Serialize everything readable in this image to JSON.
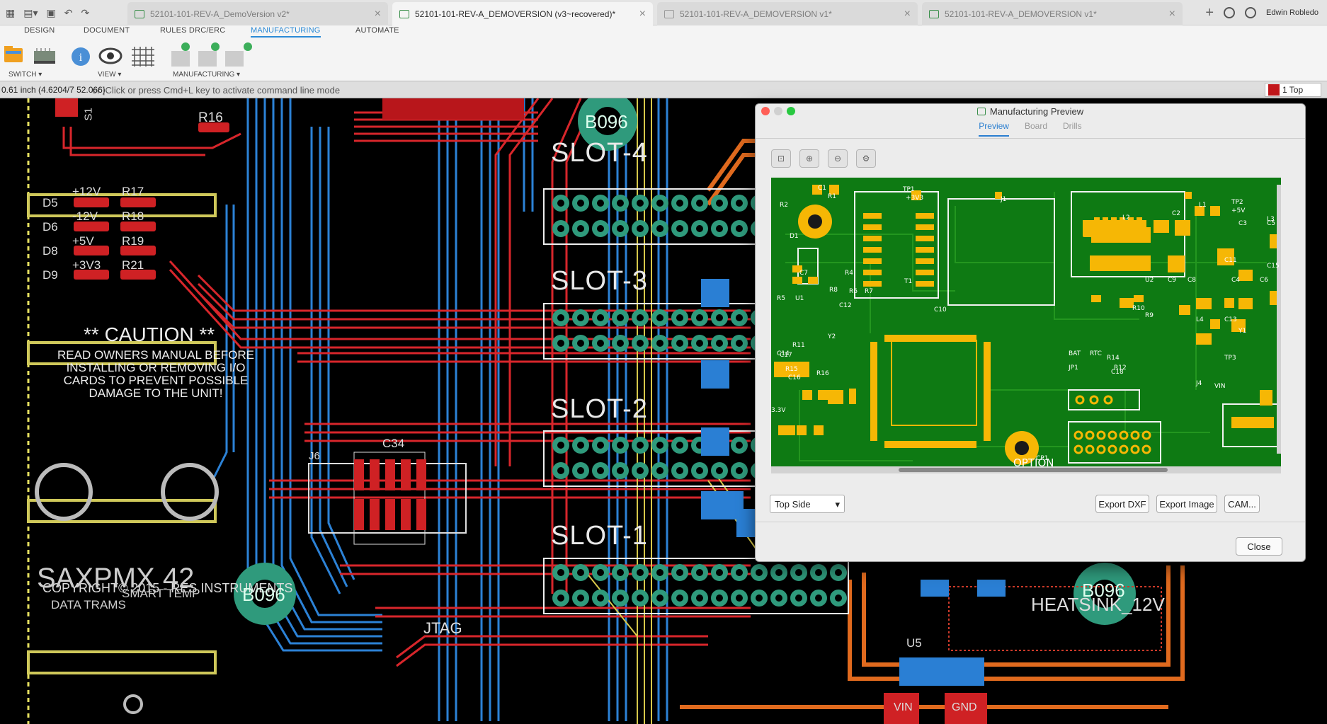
{
  "tabs": [
    {
      "label": "52101-101-REV-A_DemoVersion v2*",
      "active": false
    },
    {
      "label": "52101-101-REV-A_DEMOVERSION (v3~recovered)*",
      "active": true
    },
    {
      "label": "52101-101-REV-A_DEMOVERSION v1*",
      "active": false
    },
    {
      "label": "52101-101-REV-A_DEMOVERSION v1*",
      "active": false
    }
  ],
  "user": "Edwin Robledo",
  "menu": [
    "DESIGN",
    "DOCUMENT",
    "RULES DRC/ERC",
    "MANUFACTURING",
    "AUTOMATE"
  ],
  "groups": {
    "switch": "SWITCH ▾",
    "view": "VIEW ▾",
    "manufacturing": "MANUFACTURING ▾"
  },
  "cmdline": {
    "coords": "0.61 inch (4.6204/7 52.066)",
    "hint": "or |Click or press Cmd+L key to activate command line mode",
    "layer": "1 Top"
  },
  "board": {
    "slots": [
      "SLOT-4",
      "SLOT-3",
      "SLOT-2",
      "SLOT-1"
    ],
    "caution_title": "** CAUTION **",
    "caution_body": [
      "READ OWNERS MANUAL BEFORE",
      "INSTALLING OR REMOVING I/O",
      "CARDS TO PREVENT POSSIBLE",
      "DAMAGE TO THE UNIT!"
    ],
    "copyright": "COPYRIGHT© 2015 - RES INSTRUMENTS",
    "hole_labels": [
      "B096",
      "B096",
      "B096"
    ],
    "heatsink": "HEATSINK_12V",
    "jtag": "JTAG",
    "refs": [
      "R16",
      "D5",
      "D6",
      "D8",
      "D9",
      "+12V",
      "-12V",
      "+5V",
      "+3V3",
      "R17",
      "R18",
      "R19",
      "R21",
      "C34",
      "U5",
      "VIN",
      "GND",
      "J6",
      "S1"
    ],
    "logo": [
      "SAXPMX 42",
      "SMART TEMP",
      "DATA TRAMS"
    ]
  },
  "dialog": {
    "title": "Manufacturing Preview",
    "tabs": [
      "Preview",
      "Board",
      "Drills"
    ],
    "side": "Top Side",
    "buttons": {
      "export_dxf": "Export DXF",
      "export_image": "Export Image",
      "cam": "CAM...",
      "close": "Close"
    },
    "preview_labels": [
      "C1",
      "R1",
      "TP1",
      "+3V3",
      "J1",
      "R2",
      "D1",
      "C7",
      "R4",
      "T1",
      "R5",
      "U1",
      "R8",
      "R6",
      "R7",
      "C12",
      "C10",
      "R10",
      "L2",
      "C2",
      "L1",
      "TP2",
      "+5V",
      "C3",
      "C5",
      "C6",
      "U2",
      "C9",
      "C8",
      "C4",
      "C11",
      "R9",
      "L4",
      "C13",
      "Y1",
      "C14",
      "Y2",
      "R11",
      "C17",
      "R15",
      "C16",
      "R16",
      "3.3V",
      "BAT",
      "RTC",
      "JP1",
      "R12",
      "R14",
      "C18",
      "TP3",
      "VIN",
      "J4",
      "OPTION",
      "CP1",
      "L3",
      "C15"
    ]
  }
}
